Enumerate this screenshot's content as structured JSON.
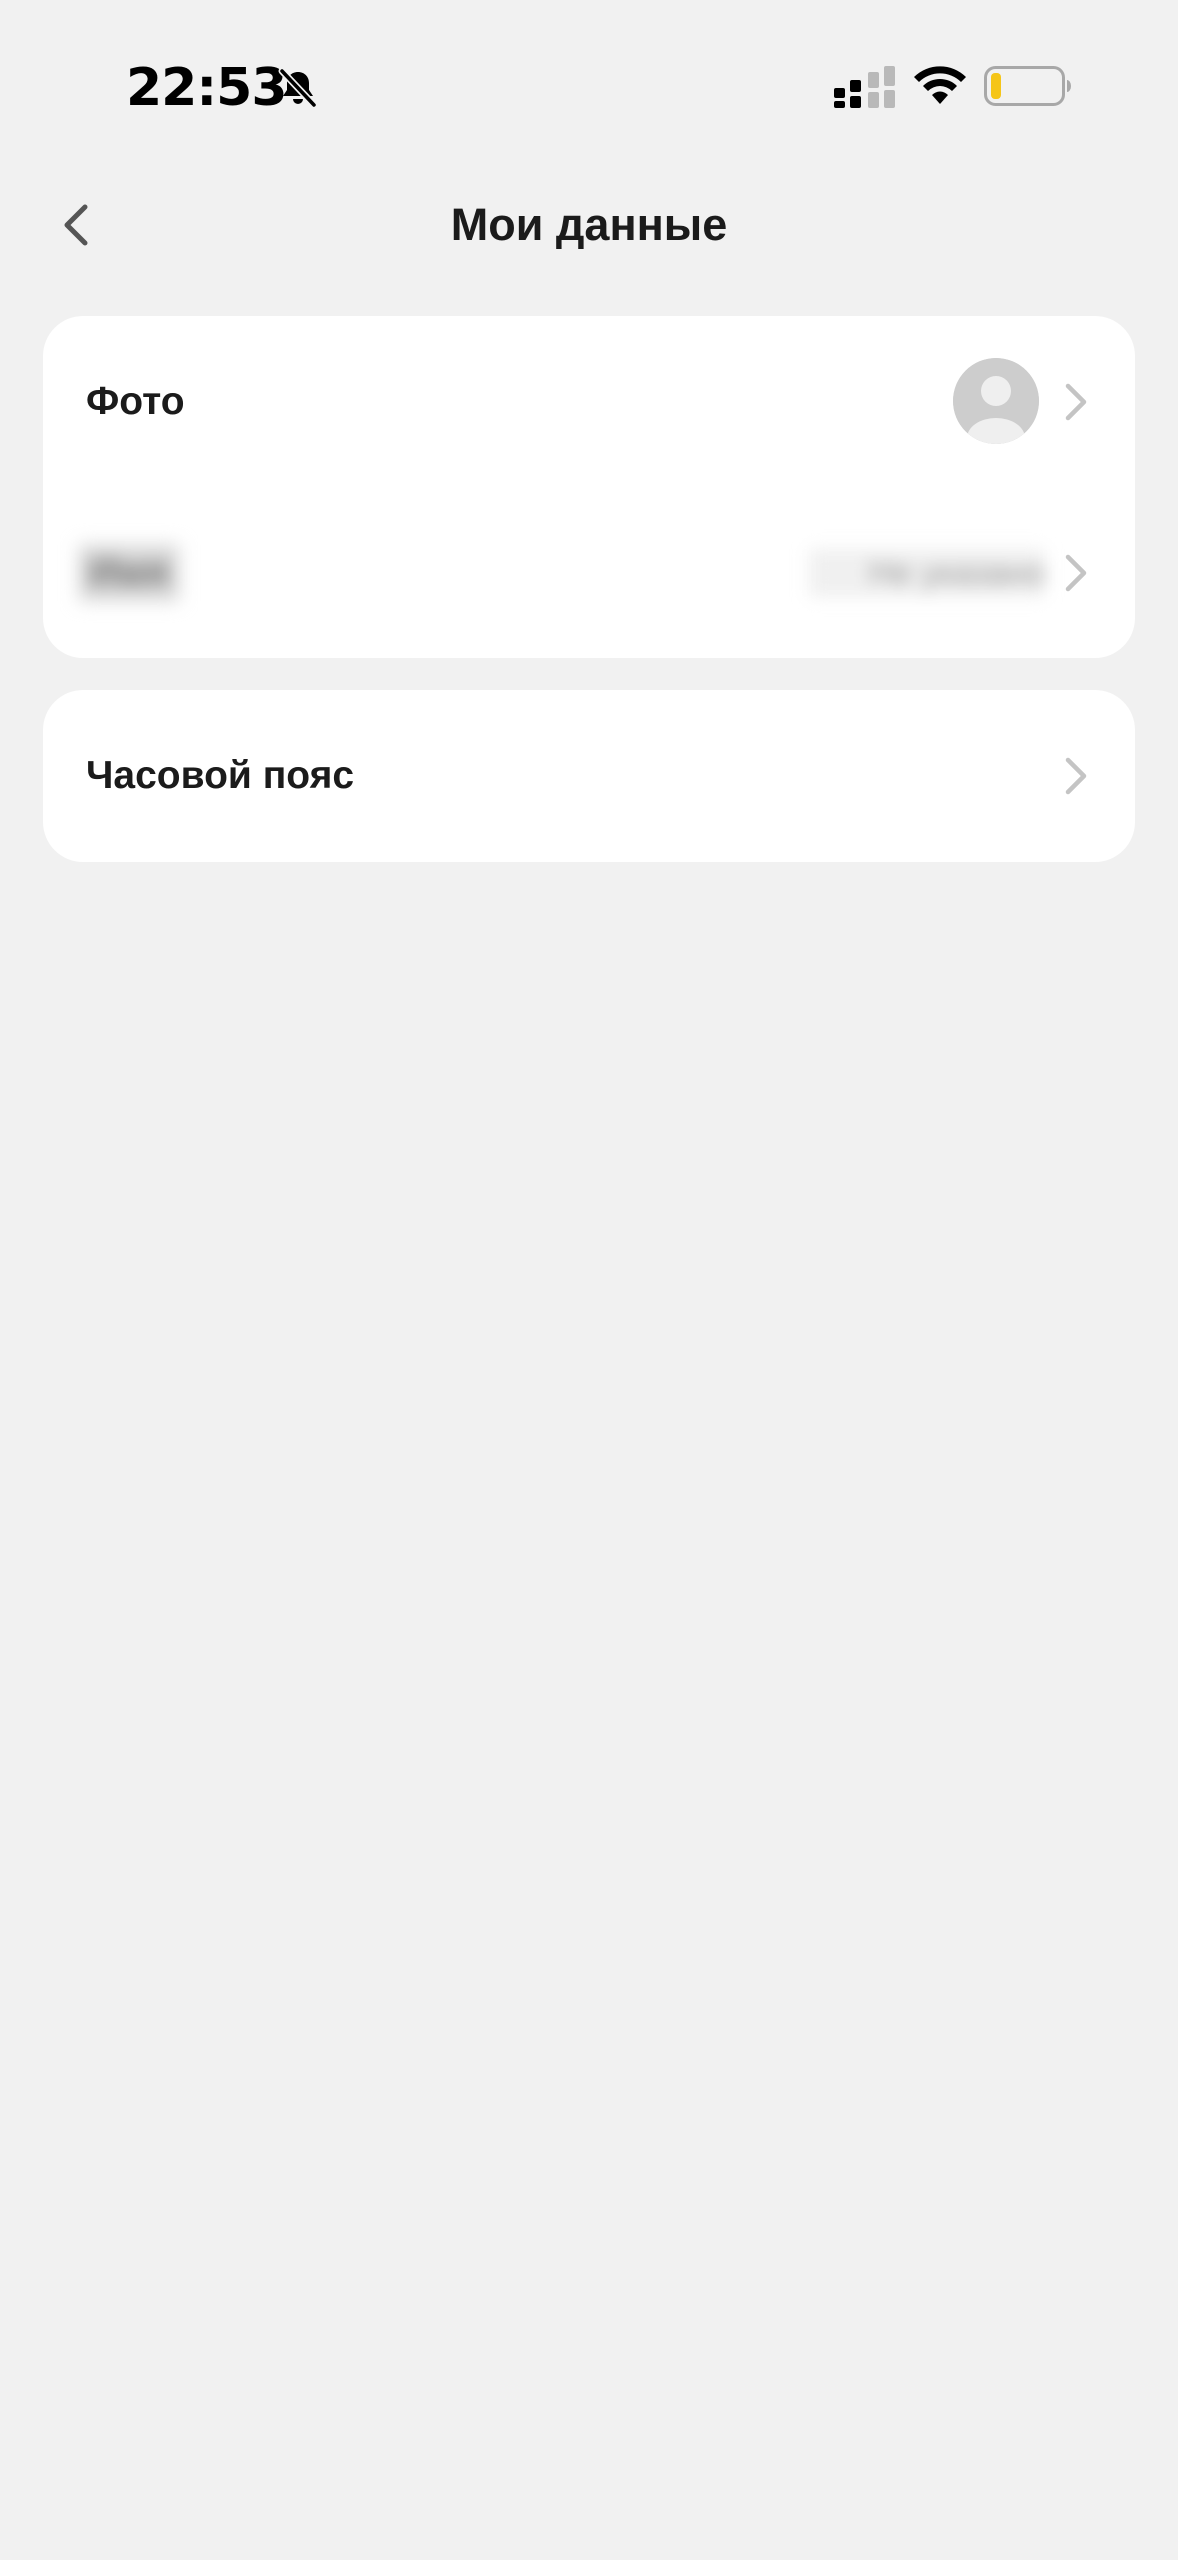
{
  "status_bar": {
    "time": "22:53",
    "icons": [
      "bell-slash-icon",
      "signal-icon",
      "wifi-icon",
      "battery-icon"
    ],
    "battery_level": 0.12,
    "battery_color": "#f5c518"
  },
  "header": {
    "title": "Мои данные",
    "back_icon": "chevron-left-icon"
  },
  "profile_card": {
    "photo_label": "Фото",
    "name_label": "Имя",
    "name_value": "Не указано",
    "avatar_icon": "user-placeholder-icon",
    "chevron_icon": "chevron-right-icon"
  },
  "settings_card": {
    "timezone_label": "Часовой пояс",
    "chevron_icon": "chevron-right-icon"
  },
  "colors": {
    "background": "#f1f1f1",
    "card": "#ffffff",
    "text": "#1b1b1b",
    "chevron": "#c4c4c4"
  }
}
